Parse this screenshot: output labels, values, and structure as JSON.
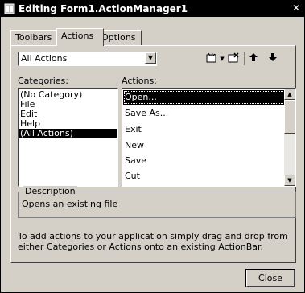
{
  "window": {
    "title": "Editing Form1.ActionManager1",
    "close_glyph": "✕"
  },
  "tabs": [
    {
      "label": "Toolbars",
      "active": false
    },
    {
      "label": "Actions",
      "active": true
    },
    {
      "label": "Options",
      "active": false
    }
  ],
  "filter_combo": {
    "value": "All Actions",
    "arrow": "▼"
  },
  "toolbar_icons": [
    "new-action-icon",
    "dropdown-arrow-icon",
    "delete-action-icon",
    "move-up-icon",
    "move-down-icon"
  ],
  "categories": {
    "label": "Categories:",
    "items": [
      "(No Category)",
      "File",
      "Edit",
      "Help",
      "(All Actions)"
    ],
    "selected_index": 4
  },
  "actions": {
    "label": "Actions:",
    "items": [
      "Open...",
      "Save As...",
      "Exit",
      "New",
      "Save",
      "Cut"
    ],
    "selected_index": 0
  },
  "description": {
    "legend": "Description",
    "text": "Opens an existing file"
  },
  "hint_text": "To add actions to your application simply drag and drop from either Categories or Actions onto an existing ActionBar.",
  "close_button": "Close"
}
